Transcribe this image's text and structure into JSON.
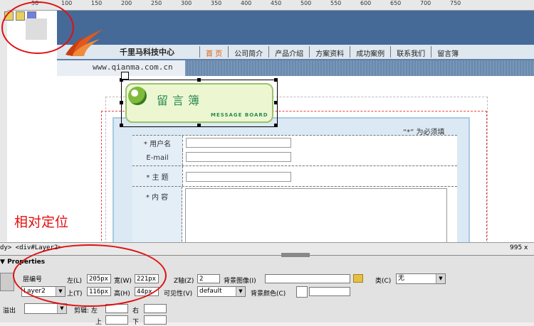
{
  "ruler": {
    "ticks": [
      "50",
      "100",
      "150",
      "200",
      "250",
      "300",
      "350",
      "400",
      "450",
      "500",
      "550",
      "600",
      "650",
      "700",
      "750"
    ]
  },
  "site": {
    "company": "千里马科技中心",
    "url": "www.qianma.com.cn",
    "nav": [
      "首 页",
      "公司简介",
      "产品介绍",
      "方案资料",
      "成功案例",
      "联系我们",
      "留言簿"
    ],
    "nav_active_color": "#e25c00"
  },
  "board": {
    "title": "留言簿",
    "subtitle": "MESSAGE BOARD",
    "required_note": "“*” 为必须填",
    "fields": [
      {
        "label": "* 用户名"
      },
      {
        "label": "E-mail"
      },
      {
        "label": "* 主 题"
      },
      {
        "label": "* 内 容"
      }
    ]
  },
  "annotation": {
    "text": "相对定位",
    "color": "#e01010"
  },
  "status": {
    "tagpath": "dy> <div#Layer2>",
    "size": "995 x"
  },
  "properties": {
    "title": "Properties",
    "layer_id_label": "层编号",
    "layer_id_value": "Layer2",
    "left_label": "左(L)",
    "left_value": "205px",
    "width_label": "宽(W)",
    "width_value": "221px",
    "top_label": "上(T)",
    "top_value": "116px",
    "height_label": "高(H)",
    "height_value": "44px",
    "z_label": "Z轴(Z)",
    "z_value": "2",
    "bg_image_label": "背景图像(I)",
    "class_label": "类(C)",
    "class_value": "无",
    "vis_label": "可见性(V)",
    "vis_value": "default",
    "bg_color_label": "背景颜色(C)",
    "overflow_label": "溢出",
    "clip_label": "剪辑: 左",
    "clip_right": "右",
    "clip_top": "上",
    "clip_bottom": "下"
  }
}
